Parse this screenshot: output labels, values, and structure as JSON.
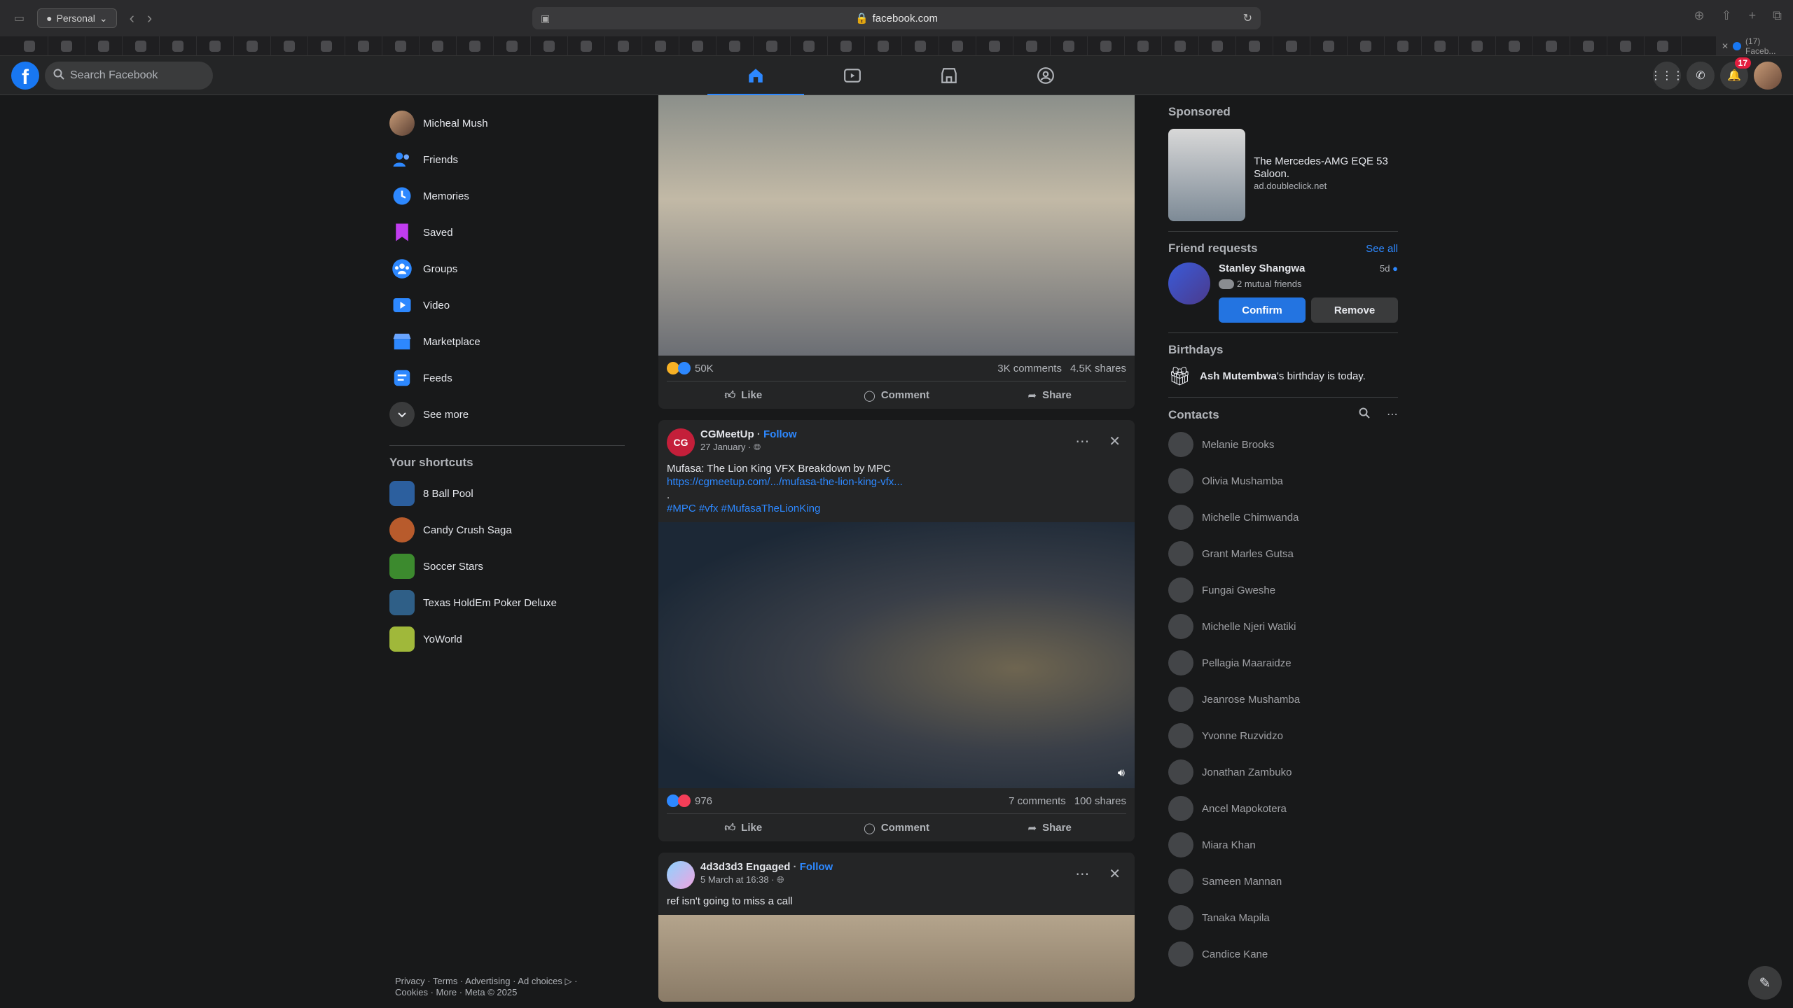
{
  "browser": {
    "profile": "Personal",
    "url": "facebook.com",
    "active_tab_title": "(17) Faceb..."
  },
  "fb_nav": {
    "search_placeholder": "Search Facebook",
    "tabs": [
      "home",
      "video",
      "marketplace",
      "groups"
    ],
    "notifications_count": "17"
  },
  "left_sidebar": {
    "items": [
      {
        "label": "Micheal Mush",
        "icon": "profile-avatar"
      },
      {
        "label": "Friends",
        "icon": "friends-icon"
      },
      {
        "label": "Memories",
        "icon": "clock-icon"
      },
      {
        "label": "Saved",
        "icon": "bookmark-icon"
      },
      {
        "label": "Groups",
        "icon": "groups-icon"
      },
      {
        "label": "Video",
        "icon": "video-icon"
      },
      {
        "label": "Marketplace",
        "icon": "shop-icon"
      },
      {
        "label": "Feeds",
        "icon": "feeds-icon"
      },
      {
        "label": "See more",
        "icon": "chevron-down-icon"
      }
    ],
    "shortcuts_heading": "Your shortcuts",
    "shortcuts": [
      {
        "label": "8 Ball Pool",
        "color": "#2c5f9e"
      },
      {
        "label": "Candy Crush Saga",
        "color": "#b85b2c"
      },
      {
        "label": "Soccer Stars",
        "color": "#3c8a2e"
      },
      {
        "label": "Texas HoldEm Poker Deluxe",
        "color": "#2f5f87"
      },
      {
        "label": "YoWorld",
        "color": "#a0b83a"
      }
    ],
    "footer_line1": "Privacy · Terms · Advertising · Ad choices ▷ ·",
    "footer_line2": "Cookies · More · Meta © 2025"
  },
  "feed": {
    "post1": {
      "reactions": "50K",
      "comments": "3K comments",
      "shares": "4.5K shares"
    },
    "post2": {
      "author": "CGMeetUp",
      "follow": "Follow",
      "date": "27 January",
      "text": "Mufasa: The Lion King VFX Breakdown by MPC",
      "link": "https://cgmeetup.com/.../mufasa-the-lion-king-vfx...",
      "dot": ".",
      "hashtags": "#MPC #vfx #MufasaTheLionKing",
      "reactions": "976",
      "comments": "7 comments",
      "shares": "100 shares"
    },
    "post3": {
      "author": "4d3d3d3 Engaged",
      "follow": "Follow",
      "date": "5 March at 16:38",
      "text": "ref isn't going to miss a call"
    },
    "actions": {
      "like": "Like",
      "comment": "Comment",
      "share": "Share"
    }
  },
  "right_col": {
    "sponsored_heading": "Sponsored",
    "ad_title": "The Mercedes-AMG EQE 53 Saloon.",
    "ad_url": "ad.doubleclick.net",
    "friend_requests_heading": "Friend requests",
    "see_all": "See all",
    "request": {
      "name": "Stanley Shangwa",
      "time": "5d",
      "mutual": "2 mutual friends",
      "confirm": "Confirm",
      "remove": "Remove"
    },
    "birthdays_heading": "Birthdays",
    "birthday_name": "Ash Mutembwa",
    "birthday_suffix": "'s birthday is today.",
    "contacts_heading": "Contacts",
    "contacts": [
      "Melanie Brooks",
      "Olivia Mushamba",
      "Michelle Chimwanda",
      "Grant Marles Gutsa",
      "Fungai Gweshe",
      "Michelle Njeri Watiki",
      "Pellagia Maaraidze",
      "Jeanrose Mushamba",
      "Yvonne Ruzvidzo",
      "Jonathan Zambuko",
      "Ancel Mapokotera",
      "Miara Khan",
      "Sameen Mannan",
      "Tanaka Mapila",
      "Candice Kane"
    ]
  }
}
